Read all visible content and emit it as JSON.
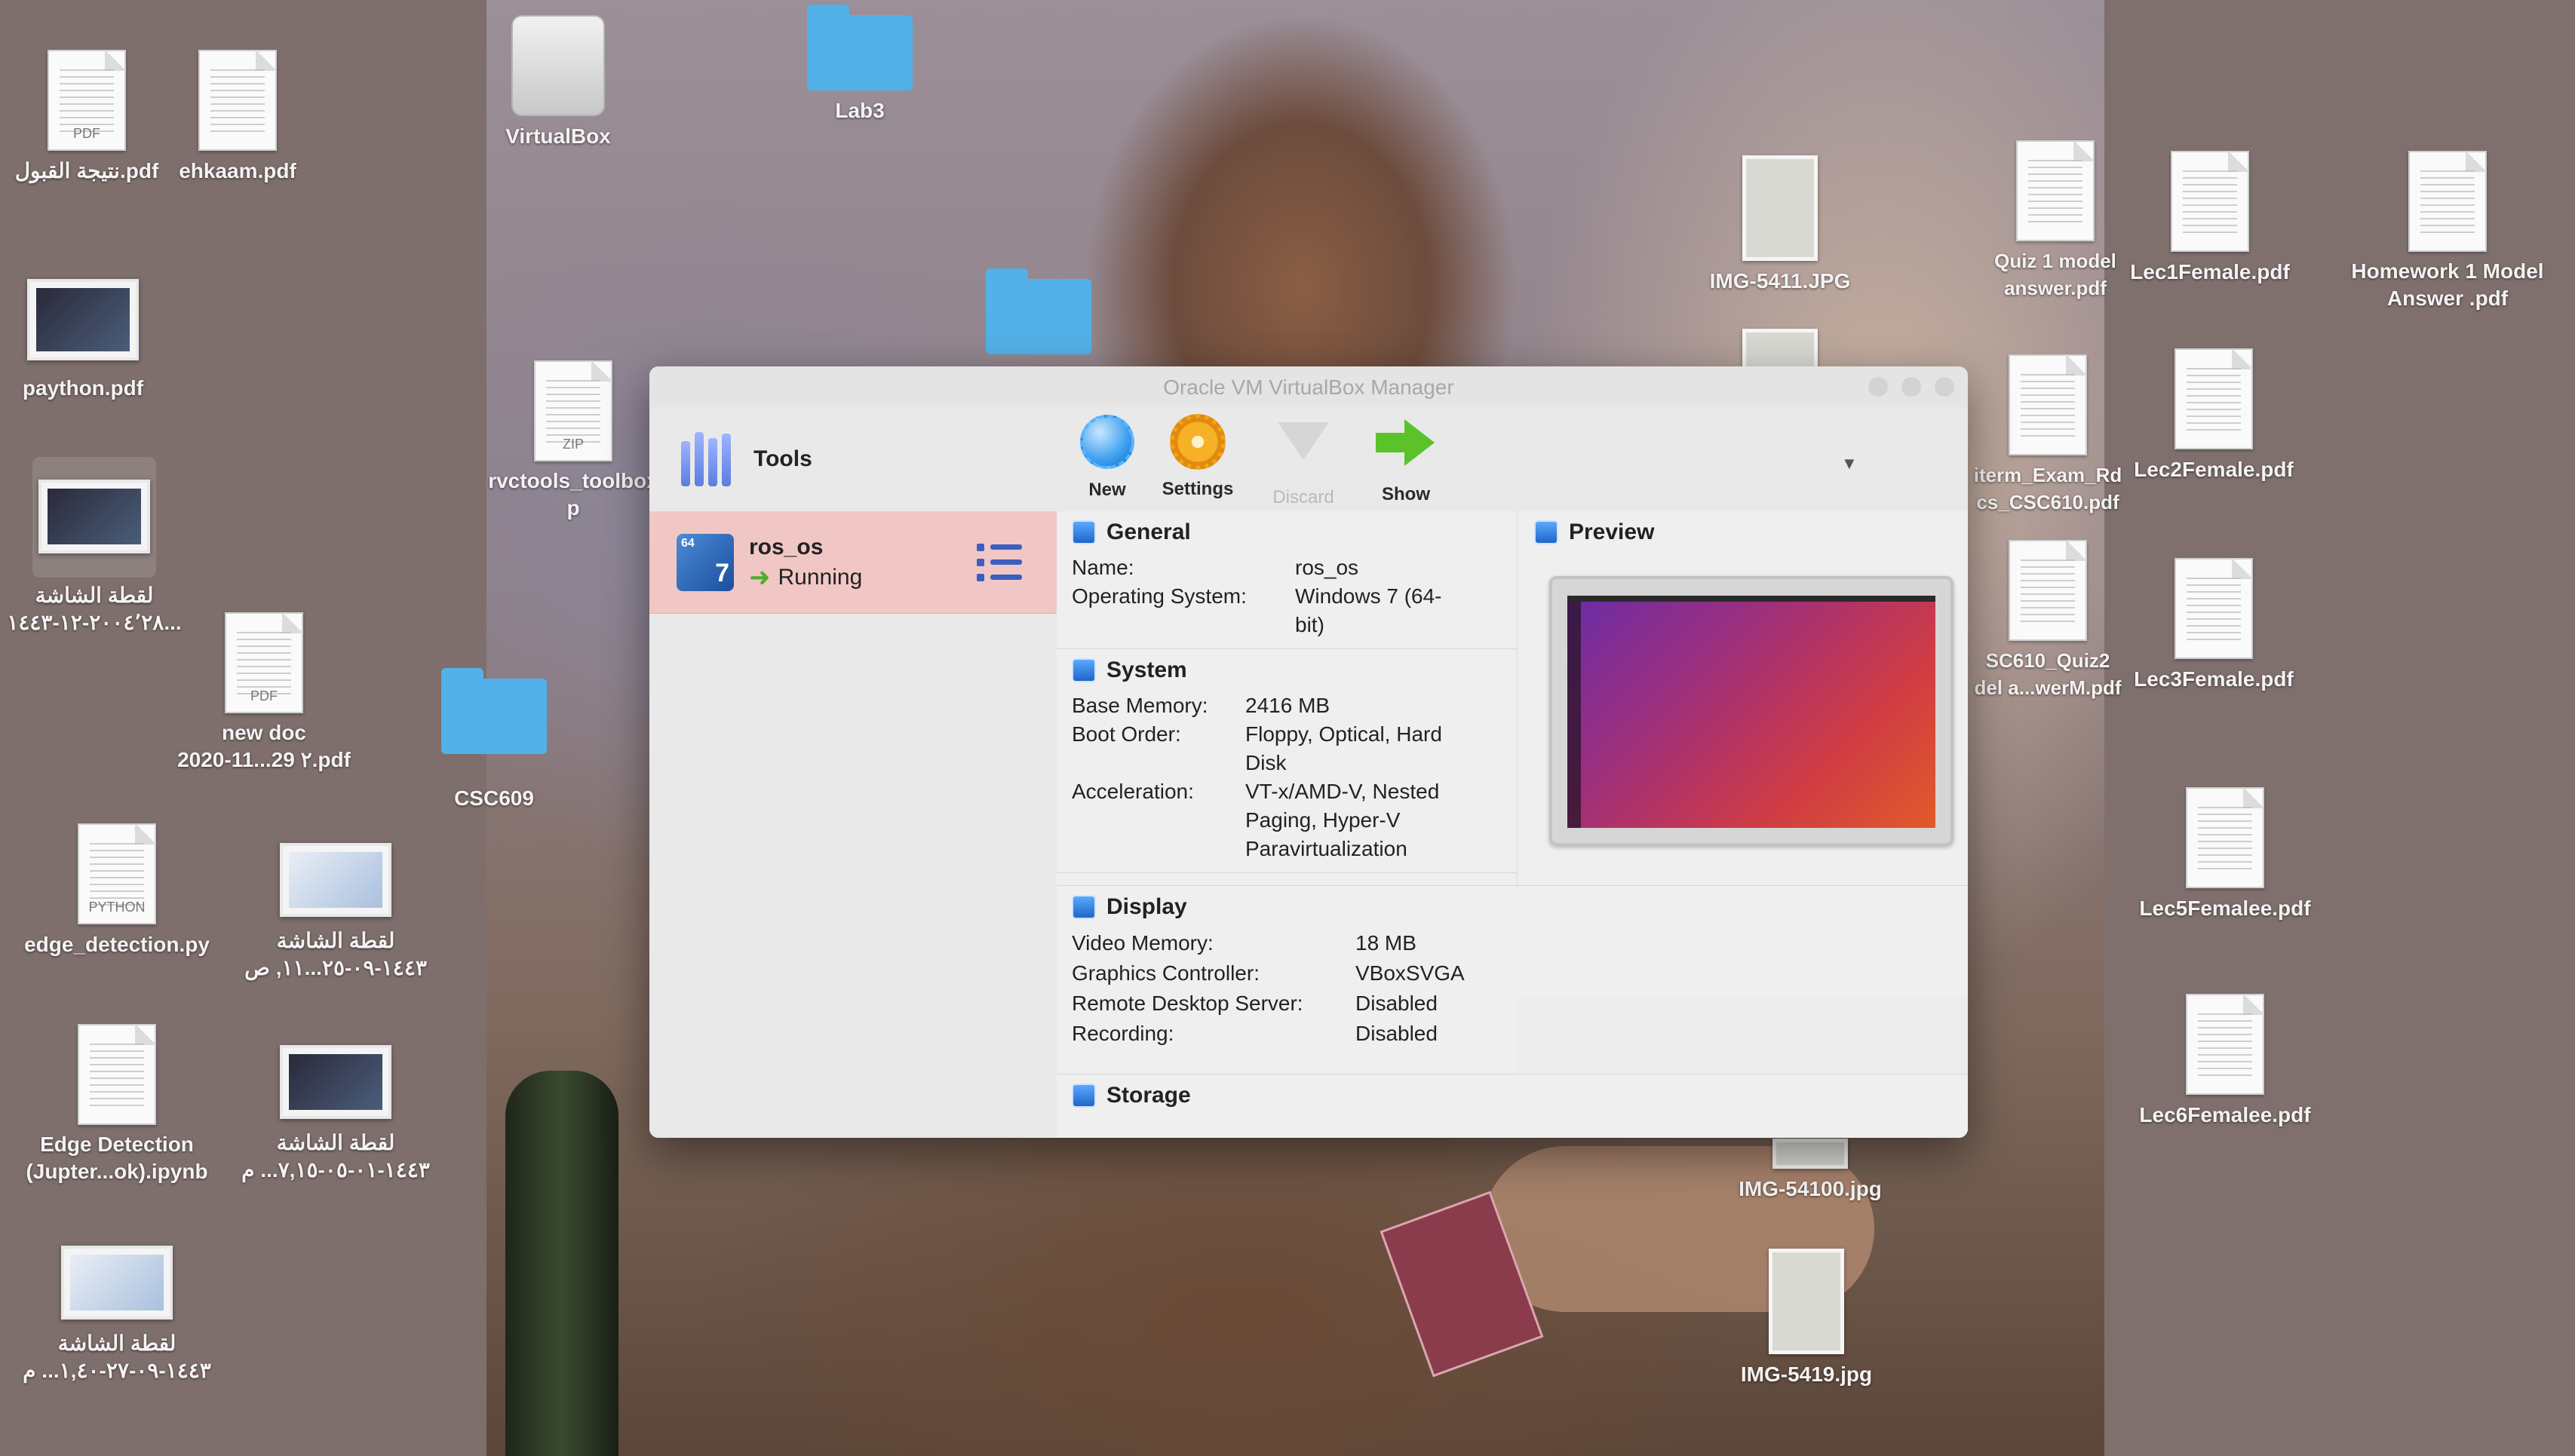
{
  "desktop": {
    "icons_left": [
      {
        "label": "نتيجة القبول.pdf",
        "tag": "PDF"
      },
      {
        "label": "ehkaam.pdf"
      },
      {
        "label": "paython.pdf"
      },
      {
        "label": "لقطة الشاشة",
        "label2": "٢٠٠٤٬٢٨-١٢-١٤٤٣..."
      },
      {
        "label": "new doc",
        "label2": "2020-11...29 ٢.pdf",
        "tag": "PDF"
      },
      {
        "label": "edge_detection.py",
        "tag": "PYTHON"
      },
      {
        "label": "لقطة الشاشة",
        "label2": "١٤٤٣-٠٩-٢٥...١١, ص"
      },
      {
        "label": "Edge Detection",
        "label2": "(Jupter...ok).ipynb"
      },
      {
        "label": "لقطة الشاشة",
        "label2": "١٤٤٣-٠١-٠٥-٧,١٥... م"
      },
      {
        "label": "لقطة الشاشة",
        "label2": "١٤٤٣-٠٩-٢٧-١,٤٠... م"
      }
    ],
    "icons_wallpaper": [
      {
        "label": "VirtualBox"
      },
      {
        "label": "Lab3"
      },
      {
        "label": "rvctools_toolbox",
        "label2": "p",
        "tag": "ZIP"
      },
      {
        "label": "CSC609"
      },
      {
        "label": "IMG-5411.JPG"
      },
      {
        "label": "IMG-54100.jpg"
      },
      {
        "label": "IMG-5419.jpg"
      }
    ],
    "icons_right": [
      {
        "label": "Quiz 1 model",
        "label2": "answer.pdf"
      },
      {
        "label": "Lec1Female.pdf"
      },
      {
        "label": "Homework 1 Model",
        "label2": "Answer .pdf"
      },
      {
        "label": "iterm_Exam_Rd",
        "label2": "cs_CSC610.pdf"
      },
      {
        "label": "Lec2Female.pdf"
      },
      {
        "label": "SC610_Quiz2",
        "label2": "del a...werM.pdf"
      },
      {
        "label": "Lec3Female.pdf"
      },
      {
        "label": "Lec5Femalee.pdf"
      },
      {
        "label": "Lec6Femalee.pdf"
      }
    ]
  },
  "window": {
    "title": "Oracle VM VirtualBox Manager",
    "tools_label": "Tools",
    "vm": {
      "name": "ros_os",
      "state": "Running",
      "logo_badge": "64",
      "logo_num": "7"
    },
    "toolbar": {
      "new": "New",
      "settings": "Settings",
      "discard": "Discard",
      "show": "Show",
      "caret": "▼"
    },
    "general": {
      "title": "General",
      "rows": [
        {
          "k": "Name:",
          "v": "ros_os"
        },
        {
          "k": "Operating System:",
          "v": "Windows 7 (64-\nbit)"
        }
      ]
    },
    "system": {
      "title": "System",
      "rows": [
        {
          "k": "Base Memory:",
          "v": "2416 MB"
        },
        {
          "k": "Boot Order:",
          "v": "Floppy, Optical, Hard\nDisk"
        },
        {
          "k": "Acceleration:",
          "v": "VT-x/AMD-V, Nested\nPaging, Hyper-V\nParavirtualization"
        }
      ]
    },
    "preview": {
      "title": "Preview"
    },
    "display": {
      "title": "Display",
      "rows": [
        {
          "k": "Video Memory:",
          "v": "18 MB"
        },
        {
          "k": "Graphics Controller:",
          "v": "VBoxSVGA"
        },
        {
          "k": "Remote Desktop Server:",
          "v": "Disabled"
        },
        {
          "k": "Recording:",
          "v": "Disabled"
        }
      ]
    },
    "storage": {
      "title": "Storage"
    }
  },
  "colors": {
    "selected_row": "#f1c7c5",
    "folder": "#52b1e8",
    "highlight_label": "#d92b2b"
  }
}
